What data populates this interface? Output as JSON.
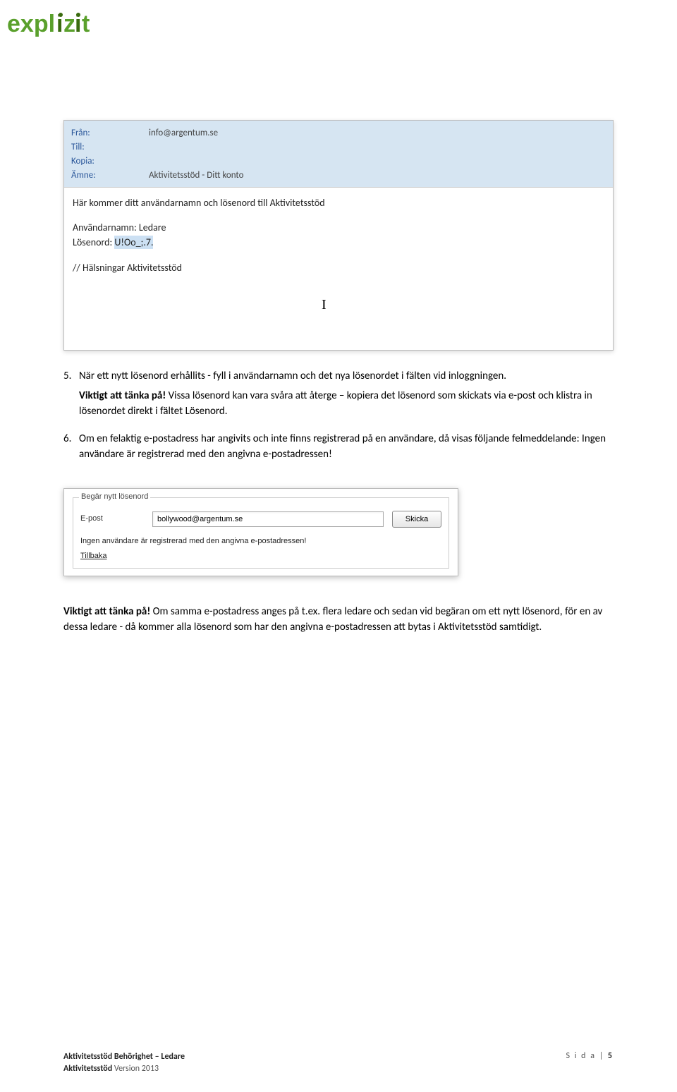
{
  "logo": {
    "text": "explizit"
  },
  "emailPanel": {
    "headers": {
      "fromLabel": "Från:",
      "fromValue": "info@argentum.se",
      "toLabel": "Till:",
      "toValue": "",
      "ccLabel": "Kopia:",
      "ccValue": "",
      "subjectLabel": "Ämne:",
      "subjectValue": "Aktivitetsstöd - Ditt konto"
    },
    "body": {
      "intro": "Här kommer ditt användarnamn och lösenord till Aktivitetsstöd",
      "userLine": "Användarnamn: Ledare",
      "passLabel": "Lösenord: ",
      "passValue": "U!Oo_;.7.",
      "signoff": "// Hälsningar Aktivitetsstöd"
    }
  },
  "doc": {
    "step5": {
      "num": "5.",
      "text": "När ett nytt lösenord erhållits - fyll i användarnamn och det nya lösenordet i fälten vid inloggningen.",
      "importantLabel": "Viktigt att tänka på!",
      "importantText": " Vissa lösenord kan vara svåra att återge – kopiera det lösenord som skickats via e-post och klistra in lösenordet direkt i fältet Lösenord."
    },
    "step6": {
      "num": "6.",
      "text": "Om en felaktig e-postadress har angivits och inte finns registrerad på en användare, då visas följande felmeddelande: Ingen användare är registrerad med den angivna e-postadressen!"
    },
    "final": {
      "importantLabel": "Viktigt att tänka på!",
      "importantText": " Om samma e-postadress anges på t.ex. flera ledare och sedan vid begäran om ett nytt lösenord, för en av dessa ledare - då kommer alla lösenord som har den angivna e-postadressen att bytas i Aktivitetsstöd samtidigt."
    }
  },
  "formPanel": {
    "legend": "Begär nytt lösenord",
    "emailLabel": "E-post",
    "emailValue": "bollywood@argentum.se",
    "submitLabel": "Skicka",
    "errorMsg": "Ingen användare är registrerad med den angivna e-postadressen!",
    "backLabel": "Tillbaka"
  },
  "footer": {
    "leftLine1Bold": "Aktivitetsstöd Behörighet – Ledare",
    "leftLine2Bold": "Aktivitetsstöd",
    "leftLine2Rest": " Version 2013",
    "rightLabel": "S i d a | ",
    "pageNum": "5"
  }
}
